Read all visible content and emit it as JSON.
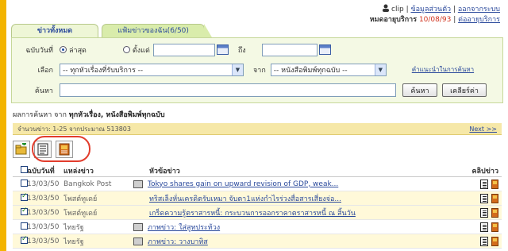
{
  "user": {
    "name": "clip",
    "account_info_link": "ข้อมูลส่วนตัว",
    "logout_link": "ออกจากระบบ",
    "expire_label": "หมดอายุบริการ",
    "expire_date": "10/08/93",
    "renew_link": "ต่ออายุบริการ"
  },
  "tabs": [
    {
      "label": "ข่าวทั้งหมด",
      "active": true
    },
    {
      "label": "แฟ้มข่าวของฉัน(6/50)",
      "active": false
    }
  ],
  "search_form": {
    "date_label": "ฉบับวันที่",
    "latest_label": "ล่าสุด",
    "since_label": "ตั้งแต่",
    "to_label": "ถึง",
    "date_from_value": "",
    "date_to_value": "",
    "choose_label": "เลือก",
    "topic_select": "-- ทุกหัวเรื่องที่รับบริการ --",
    "from_label": "จาก",
    "source_select": "-- หนังสือพิมพ์ทุกฉบับ --",
    "help_link": "คำแนะนำในการค้นหา",
    "keyword_label": "ค้นหา",
    "keyword_value": "",
    "search_button": "ค้นหา",
    "clear_button": "เคลียร์ค่า"
  },
  "results": {
    "heading_prefix": "ผลการค้นหา จาก",
    "heading_scope": "ทุกหัวเรื่อง, หนังสือพิมพ์ทุกฉบับ",
    "count_text": "จำนวนข่าว: 1-25 จากประมาณ 513803",
    "next_link": "Next >>"
  },
  "table": {
    "headers": {
      "date": "ฉบับวันที่",
      "source": "แหล่งข่าว",
      "title": "หัวข้อข่าว",
      "clip": "คลิปข่าว"
    },
    "rows": [
      {
        "checked": false,
        "date": "13/03/50",
        "source": "Bangkok Post",
        "has_pic": true,
        "title": "Tokyo shares gain on upward revision of GDP, weak..."
      },
      {
        "checked": true,
        "date": "13/03/50",
        "source": "โพสต์ทูเดย์",
        "has_pic": false,
        "title": "ทริสเล็งหั่นเครดิตรับเหมา จับตา1แห่งกำไรร่วงสื่อสารเสี่ยงจ่อ..."
      },
      {
        "checked": true,
        "date": "13/03/50",
        "source": "โพสต์ทูเดย์",
        "has_pic": false,
        "title": "เกร็ดความรู้ตราสารหนี้: กระบวนการออกราคาตราสารหนี้ ณ สิ้นวัน"
      },
      {
        "checked": false,
        "date": "13/03/50",
        "source": "ไทยรัฐ",
        "has_pic": true,
        "title": "ภาพข่าว: ใส่สูทประท้วง"
      },
      {
        "checked": true,
        "date": "13/03/50",
        "source": "ไทยรัฐ",
        "has_pic": true,
        "title": "ภาพข่าว: วางบาทิส"
      }
    ]
  }
}
